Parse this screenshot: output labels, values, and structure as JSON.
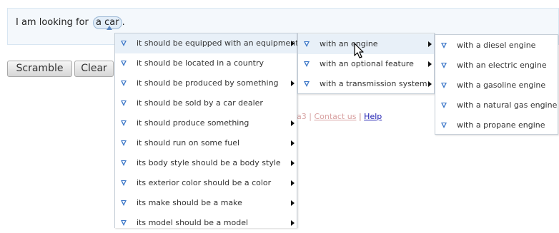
{
  "query": {
    "prefix": "I am looking for",
    "chip": "a car",
    "suffix": "."
  },
  "buttons": {
    "scramble": "Scramble",
    "clear": "Clear"
  },
  "footer": {
    "fragment": "a3 |",
    "contact": "Contact us",
    "separator": "|",
    "help": "Help"
  },
  "menu_level1": {
    "items": [
      {
        "label": "it should be equipped with an equipment",
        "submenu": true,
        "highlighted": true
      },
      {
        "label": "it should be located in a country",
        "submenu": false
      },
      {
        "label": "it should be produced by something",
        "submenu": true
      },
      {
        "label": "it should be sold by a car dealer",
        "submenu": false
      },
      {
        "label": "it should produce something",
        "submenu": true
      },
      {
        "label": "it should run on some fuel",
        "submenu": true
      },
      {
        "label": "its body style should be a body style",
        "submenu": true
      },
      {
        "label": "its exterior color should be a color",
        "submenu": true
      },
      {
        "label": "its make should be a make",
        "submenu": true
      },
      {
        "label": "its model should be a model",
        "submenu": true
      }
    ]
  },
  "menu_level2": {
    "items": [
      {
        "label": "with an engine",
        "submenu": true,
        "highlighted": true
      },
      {
        "label": "with an optional feature",
        "submenu": true
      },
      {
        "label": "with a transmission system",
        "submenu": true
      }
    ]
  },
  "menu_level3": {
    "items": [
      {
        "label": "with a diesel engine"
      },
      {
        "label": "with an electric engine"
      },
      {
        "label": "with a gasoline engine"
      },
      {
        "label": "with a natural gas engine"
      },
      {
        "label": "with a propane engine"
      }
    ]
  },
  "icons": {
    "menu_item_icon": "down-triangle-icon",
    "submenu_indicator": "right-arrow-icon",
    "cursor": "mouse-pointer-icon"
  },
  "colors": {
    "icon_blue": "#3e78c8",
    "highlight": "#e8f0f8",
    "chip_border": "#9bb7d4",
    "help_link": "#1a1ab0"
  }
}
